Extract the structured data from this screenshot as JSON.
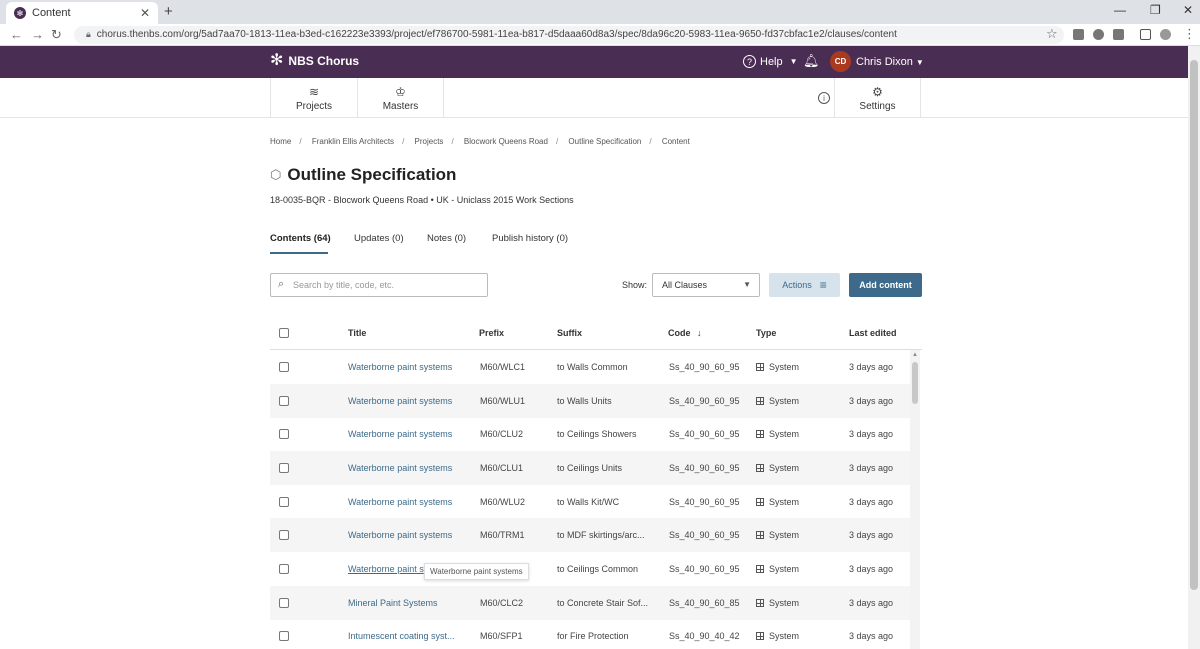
{
  "browser": {
    "tab_title": "Content",
    "url": "chorus.thenbs.com/org/5ad7aa70-1813-11ea-b3ed-c162223e3393/project/ef786700-5981-11ea-b817-d5daaa60d8a3/spec/8da96c20-5983-11ea-9650-fd37cbfac1e2/clauses/content"
  },
  "header": {
    "logo_text": "NBS Chorus",
    "help_label": "Help",
    "avatar_initials": "CD",
    "user_name": "Chris Dixon",
    "brand_color": "#4a2d53"
  },
  "subnav": {
    "projects": "Projects",
    "masters": "Masters",
    "settings": "Settings"
  },
  "breadcrumb": [
    "Home",
    "Franklin Ellis Architects",
    "Projects",
    "Blocwork Queens Road",
    "Outline Specification",
    "Content"
  ],
  "page": {
    "title": "Outline Specification",
    "subtitle": "18-0035-BQR - Blocwork Queens Road • UK - Uniclass 2015 Work Sections"
  },
  "tabs": [
    "Contents (64)",
    "Updates (0)",
    "Notes (0)",
    "Publish history (0)"
  ],
  "toolbar": {
    "search_placeholder": "Search by title, code, etc.",
    "show_label": "Show:",
    "show_value": "All Clauses",
    "actions_label": "Actions",
    "add_label": "Add content",
    "accent_color": "#3d6a8a"
  },
  "table": {
    "headers": {
      "title": "Title",
      "prefix": "Prefix",
      "suffix": "Suffix",
      "code": "Code",
      "type": "Type",
      "last_edited": "Last edited"
    },
    "rows": [
      {
        "title": "Waterborne paint systems",
        "prefix": "M60/WLC1",
        "suffix": "to Walls Common",
        "code": "Ss_40_90_60_95",
        "type": "System",
        "edited": "3 days ago"
      },
      {
        "title": "Waterborne paint systems",
        "prefix": "M60/WLU1",
        "suffix": "to Walls Units",
        "code": "Ss_40_90_60_95",
        "type": "System",
        "edited": "3 days ago"
      },
      {
        "title": "Waterborne paint systems",
        "prefix": "M60/CLU2",
        "suffix": "to Ceilings Showers",
        "code": "Ss_40_90_60_95",
        "type": "System",
        "edited": "3 days ago"
      },
      {
        "title": "Waterborne paint systems",
        "prefix": "M60/CLU1",
        "suffix": "to Ceilings Units",
        "code": "Ss_40_90_60_95",
        "type": "System",
        "edited": "3 days ago"
      },
      {
        "title": "Waterborne paint systems",
        "prefix": "M60/WLU2",
        "suffix": "to Walls Kit/WC",
        "code": "Ss_40_90_60_95",
        "type": "System",
        "edited": "3 days ago"
      },
      {
        "title": "Waterborne paint systems",
        "prefix": "M60/TRM1",
        "suffix": "to MDF skirtings/arc...",
        "code": "Ss_40_90_60_95",
        "type": "System",
        "edited": "3 days ago"
      },
      {
        "title": "Waterborne paint s",
        "prefix": "",
        "suffix": "to Ceilings Common",
        "code": "Ss_40_90_60_95",
        "type": "System",
        "edited": "3 days ago"
      },
      {
        "title": "Mineral Paint Systems",
        "prefix": "M60/CLC2",
        "suffix": "to Concrete Stair Sof...",
        "code": "Ss_40_90_60_85",
        "type": "System",
        "edited": "3 days ago"
      },
      {
        "title": "Intumescent coating syst...",
        "prefix": "M60/SFP1",
        "suffix": "for Fire Protection",
        "code": "Ss_40_90_40_42",
        "type": "System",
        "edited": "3 days ago"
      }
    ],
    "tooltip": "Waterborne paint systems"
  }
}
